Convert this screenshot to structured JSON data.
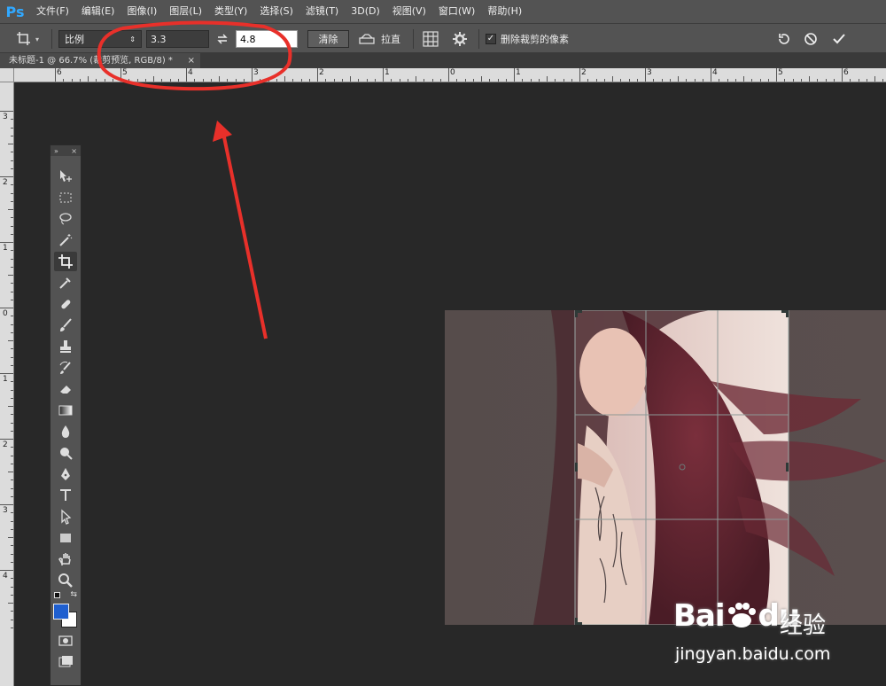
{
  "app": {
    "logo": "Ps"
  },
  "menu": [
    "文件(F)",
    "编辑(E)",
    "图像(I)",
    "图层(L)",
    "类型(Y)",
    "选择(S)",
    "滤镜(T)",
    "3D(D)",
    "视图(V)",
    "窗口(W)",
    "帮助(H)"
  ],
  "options": {
    "ratio_mode": "比例",
    "width_value": "3.3",
    "height_value": "4.8",
    "clear_label": "清除",
    "straighten_label": "拉直",
    "delete_cropped_label": "删除裁剪的像素",
    "delete_cropped_checked": true
  },
  "document": {
    "tab_title": "未标题-1 @ 66.7% (裁剪预览, RGB/8) *",
    "close": "×"
  },
  "ruler": {
    "h_labels": [
      "6",
      "5",
      "4",
      "3",
      "2",
      "1",
      "0",
      "1",
      "2",
      "3",
      "4",
      "5",
      "6"
    ],
    "v_labels": [
      "3",
      "2",
      "1",
      "0",
      "1",
      "2",
      "3",
      "4"
    ]
  },
  "toolbox_header": {
    "collapse": "»",
    "close": "×"
  },
  "watermark": {
    "brand": "Bai",
    "brand2": "du",
    "site_cn": "经验",
    "url": "jingyan.baidu.com"
  },
  "colors": {
    "accent": "#31a8ff",
    "annotation": "#e8302a",
    "foreground": "#1f5fcf",
    "background": "#ffffff"
  }
}
